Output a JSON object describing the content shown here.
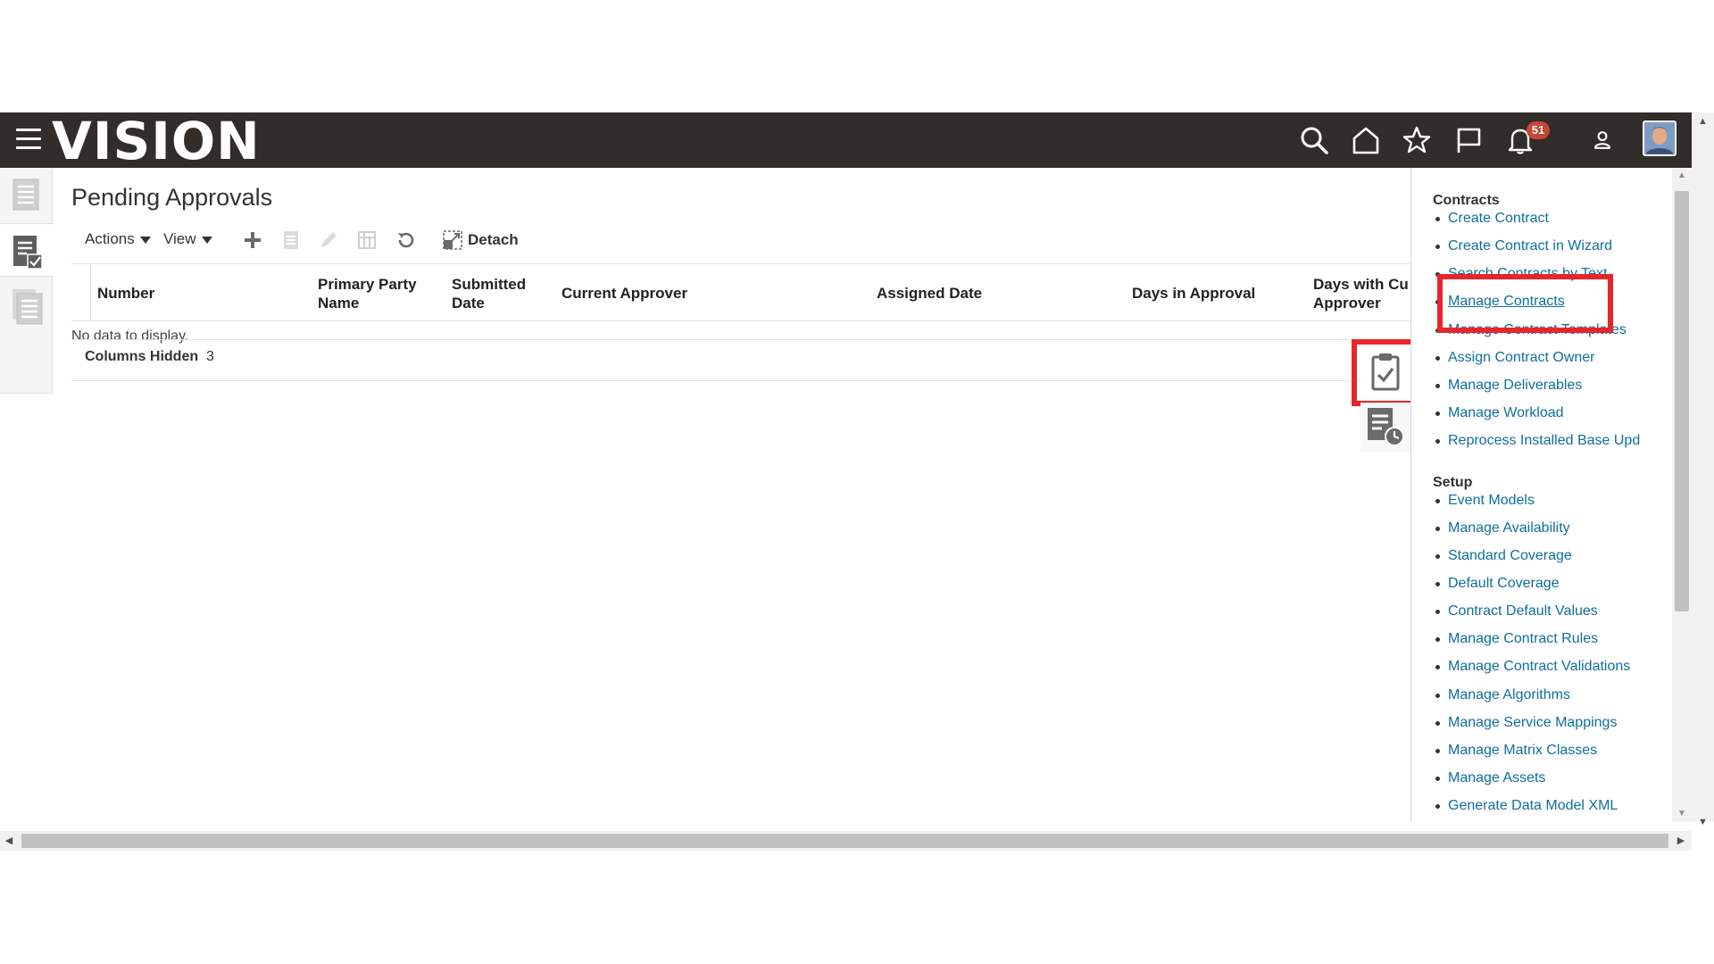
{
  "header": {
    "logo_text": "VISION",
    "notification_count": "51",
    "icons": [
      "hamburger-menu-icon",
      "search-icon",
      "home-icon",
      "favorites-star-icon",
      "watchlist-flag-icon",
      "notifications-bell-icon",
      "user-icon",
      "user-avatar"
    ]
  },
  "page": {
    "title": "Pending Approvals"
  },
  "toolbar": {
    "actions_label": "Actions",
    "view_label": "View",
    "detach_label": "Detach"
  },
  "table": {
    "columns": [
      "Number",
      "Primary Party Name",
      "Submitted Date",
      "Current Approver",
      "Assigned Date",
      "Days in Approval",
      "Days with Cu Approver"
    ],
    "empty_text": "No data to display.",
    "columns_hidden_label": "Columns Hidden",
    "columns_hidden_count": "3"
  },
  "tasks_panel": {
    "contracts_title": "Contracts",
    "contracts_links": [
      "Create Contract",
      "Create Contract in Wizard",
      "Search Contracts by Text",
      "Manage Contracts",
      "Manage Contract Templates",
      "Assign Contract Owner",
      "Manage Deliverables",
      "Manage Workload",
      "Reprocess Installed Base Upd"
    ],
    "setup_title": "Setup",
    "setup_links": [
      "Event Models",
      "Manage Availability",
      "Standard Coverage",
      "Default Coverage",
      "Contract Default Values",
      "Manage Contract Rules",
      "Manage Contract Validations",
      "Manage Algorithms",
      "Manage Service Mappings",
      "Manage Matrix Classes",
      "Manage Assets",
      "Generate Data Model XML"
    ]
  },
  "colors": {
    "header_bg": "#312d2a",
    "link": "#0e6f9c",
    "badge": "#c74634",
    "highlight": "#e8262a"
  }
}
